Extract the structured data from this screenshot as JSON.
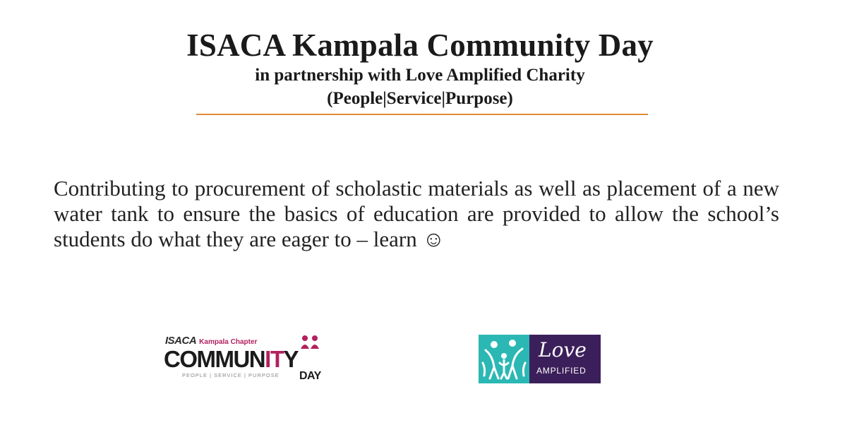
{
  "header": {
    "title": "ISACA Kampala Community Day",
    "subtitle": "in partnership with Love Amplified Charity",
    "tagline": "(People|Service|Purpose)"
  },
  "body": {
    "text": "Contributing to procurement of scholastic materials as well as placement of a new water tank to ensure the basics of education are provided to allow the school’s students do what they are eager to – learn ☺"
  },
  "logos": {
    "isaca": {
      "brand": "ISACA",
      "chapter": "Kampala Chapter",
      "word_start": "COMMUN",
      "word_highlight": "IT",
      "word_end": "Y",
      "tagline": "PEOPLE | SERVICE | PURPOSE",
      "day": "DAY",
      "accent_color": "#b3205e"
    },
    "love_amplified": {
      "love": "Love",
      "amplified": "AMPLIFIED",
      "teal_color": "#2bb8b4",
      "purple_color": "#3b1f5a"
    }
  },
  "colors": {
    "divider": "#e08a3a"
  }
}
